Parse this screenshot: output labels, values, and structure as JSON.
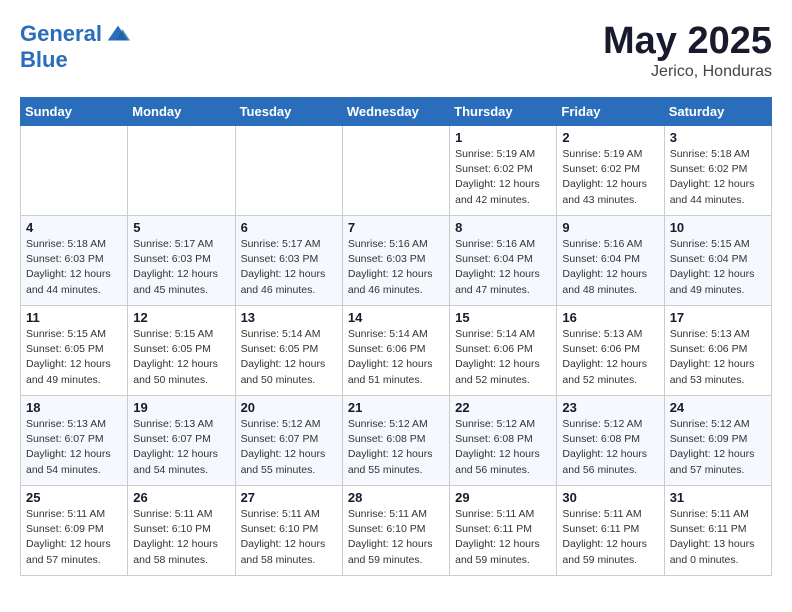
{
  "header": {
    "logo_line1": "General",
    "logo_line2": "Blue",
    "main_title": "May 2025",
    "subtitle": "Jerico, Honduras"
  },
  "weekdays": [
    "Sunday",
    "Monday",
    "Tuesday",
    "Wednesday",
    "Thursday",
    "Friday",
    "Saturday"
  ],
  "weeks": [
    [
      {
        "day": "",
        "info": ""
      },
      {
        "day": "",
        "info": ""
      },
      {
        "day": "",
        "info": ""
      },
      {
        "day": "",
        "info": ""
      },
      {
        "day": "1",
        "info": "Sunrise: 5:19 AM\nSunset: 6:02 PM\nDaylight: 12 hours\nand 42 minutes."
      },
      {
        "day": "2",
        "info": "Sunrise: 5:19 AM\nSunset: 6:02 PM\nDaylight: 12 hours\nand 43 minutes."
      },
      {
        "day": "3",
        "info": "Sunrise: 5:18 AM\nSunset: 6:02 PM\nDaylight: 12 hours\nand 44 minutes."
      }
    ],
    [
      {
        "day": "4",
        "info": "Sunrise: 5:18 AM\nSunset: 6:03 PM\nDaylight: 12 hours\nand 44 minutes."
      },
      {
        "day": "5",
        "info": "Sunrise: 5:17 AM\nSunset: 6:03 PM\nDaylight: 12 hours\nand 45 minutes."
      },
      {
        "day": "6",
        "info": "Sunrise: 5:17 AM\nSunset: 6:03 PM\nDaylight: 12 hours\nand 46 minutes."
      },
      {
        "day": "7",
        "info": "Sunrise: 5:16 AM\nSunset: 6:03 PM\nDaylight: 12 hours\nand 46 minutes."
      },
      {
        "day": "8",
        "info": "Sunrise: 5:16 AM\nSunset: 6:04 PM\nDaylight: 12 hours\nand 47 minutes."
      },
      {
        "day": "9",
        "info": "Sunrise: 5:16 AM\nSunset: 6:04 PM\nDaylight: 12 hours\nand 48 minutes."
      },
      {
        "day": "10",
        "info": "Sunrise: 5:15 AM\nSunset: 6:04 PM\nDaylight: 12 hours\nand 49 minutes."
      }
    ],
    [
      {
        "day": "11",
        "info": "Sunrise: 5:15 AM\nSunset: 6:05 PM\nDaylight: 12 hours\nand 49 minutes."
      },
      {
        "day": "12",
        "info": "Sunrise: 5:15 AM\nSunset: 6:05 PM\nDaylight: 12 hours\nand 50 minutes."
      },
      {
        "day": "13",
        "info": "Sunrise: 5:14 AM\nSunset: 6:05 PM\nDaylight: 12 hours\nand 50 minutes."
      },
      {
        "day": "14",
        "info": "Sunrise: 5:14 AM\nSunset: 6:06 PM\nDaylight: 12 hours\nand 51 minutes."
      },
      {
        "day": "15",
        "info": "Sunrise: 5:14 AM\nSunset: 6:06 PM\nDaylight: 12 hours\nand 52 minutes."
      },
      {
        "day": "16",
        "info": "Sunrise: 5:13 AM\nSunset: 6:06 PM\nDaylight: 12 hours\nand 52 minutes."
      },
      {
        "day": "17",
        "info": "Sunrise: 5:13 AM\nSunset: 6:06 PM\nDaylight: 12 hours\nand 53 minutes."
      }
    ],
    [
      {
        "day": "18",
        "info": "Sunrise: 5:13 AM\nSunset: 6:07 PM\nDaylight: 12 hours\nand 54 minutes."
      },
      {
        "day": "19",
        "info": "Sunrise: 5:13 AM\nSunset: 6:07 PM\nDaylight: 12 hours\nand 54 minutes."
      },
      {
        "day": "20",
        "info": "Sunrise: 5:12 AM\nSunset: 6:07 PM\nDaylight: 12 hours\nand 55 minutes."
      },
      {
        "day": "21",
        "info": "Sunrise: 5:12 AM\nSunset: 6:08 PM\nDaylight: 12 hours\nand 55 minutes."
      },
      {
        "day": "22",
        "info": "Sunrise: 5:12 AM\nSunset: 6:08 PM\nDaylight: 12 hours\nand 56 minutes."
      },
      {
        "day": "23",
        "info": "Sunrise: 5:12 AM\nSunset: 6:08 PM\nDaylight: 12 hours\nand 56 minutes."
      },
      {
        "day": "24",
        "info": "Sunrise: 5:12 AM\nSunset: 6:09 PM\nDaylight: 12 hours\nand 57 minutes."
      }
    ],
    [
      {
        "day": "25",
        "info": "Sunrise: 5:11 AM\nSunset: 6:09 PM\nDaylight: 12 hours\nand 57 minutes."
      },
      {
        "day": "26",
        "info": "Sunrise: 5:11 AM\nSunset: 6:10 PM\nDaylight: 12 hours\nand 58 minutes."
      },
      {
        "day": "27",
        "info": "Sunrise: 5:11 AM\nSunset: 6:10 PM\nDaylight: 12 hours\nand 58 minutes."
      },
      {
        "day": "28",
        "info": "Sunrise: 5:11 AM\nSunset: 6:10 PM\nDaylight: 12 hours\nand 59 minutes."
      },
      {
        "day": "29",
        "info": "Sunrise: 5:11 AM\nSunset: 6:11 PM\nDaylight: 12 hours\nand 59 minutes."
      },
      {
        "day": "30",
        "info": "Sunrise: 5:11 AM\nSunset: 6:11 PM\nDaylight: 12 hours\nand 59 minutes."
      },
      {
        "day": "31",
        "info": "Sunrise: 5:11 AM\nSunset: 6:11 PM\nDaylight: 13 hours\nand 0 minutes."
      }
    ]
  ]
}
